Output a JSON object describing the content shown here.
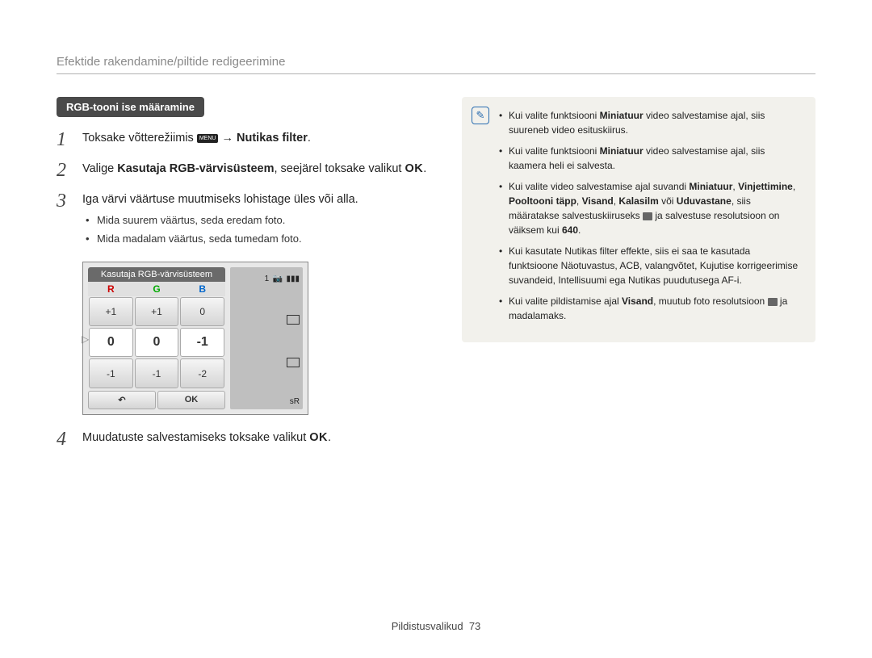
{
  "header": "Efektide rakendamine/piltide redigeerimine",
  "pill": "RGB-tooni ise määramine",
  "steps": {
    "s1_a": "Toksake võtterežiimis ",
    "s1_menu": "MENU",
    "s1_b": " → ",
    "s1_c": "Nutikas filter",
    "s1_d": ".",
    "s2_a": "Valige ",
    "s2_b": "Kasutaja RGB-värvisüsteem",
    "s2_c": ", seejärel toksake valikut ",
    "s2_ok": "OK",
    "s2_d": ".",
    "s3_a": "Iga värvi väärtuse muutmiseks lohistage üles või alla.",
    "s3_bul1": "Mida suurem väärtus, seda eredam foto.",
    "s3_bul2": "Mida madalam väärtus, seda tumedam foto.",
    "s4_a": "Muudatuste salvestamiseks toksake valikut ",
    "s4_ok": "OK",
    "s4_b": "."
  },
  "rgb": {
    "title": "Kasutaja RGB-värvisüsteem",
    "h_r": "R",
    "h_g": "G",
    "h_b": "B",
    "rows": [
      [
        "+1",
        "+1",
        "0"
      ],
      [
        "0",
        "0",
        "-1"
      ],
      [
        "-1",
        "-1",
        "-2"
      ]
    ],
    "back": "↶",
    "ok": "OK",
    "ind_top": "1",
    "sr_label": "sR"
  },
  "notes": {
    "n1_a": "Kui valite funktsiooni ",
    "n1_b": "Miniatuur",
    "n1_c": " video salvestamise ajal, siis suureneb video esituskiirus.",
    "n2_a": "Kui valite funktsiooni ",
    "n2_b": "Miniatuur",
    "n2_c": " video salvestamise ajal, siis kaamera heli ei salvesta.",
    "n3_a": "Kui valite video salvestamise ajal suvandi ",
    "n3_b": "Miniatuur",
    "n3_c": ", ",
    "n3_d": "Vinjettimine",
    "n3_e": ", ",
    "n3_f": "Pooltooni täpp",
    "n3_g": ", ",
    "n3_h": "Visand",
    "n3_i": ", ",
    "n3_j": "Kalasilm",
    "n3_k": " või ",
    "n3_l": "Uduvastane",
    "n3_m": ", siis määratakse salvestuskiiruseks ",
    "n3_n": " ja salvestuse resolutsioon on väiksem kui ",
    "n3_o": "640",
    "n3_p": ".",
    "n4": "Kui kasutate Nutikas filter effekte, siis ei saa te kasutada funktsioone Näotuvastus, ACB, valangvõtet, Kujutise korrigeerimise suvandeid, Intellisuumi ega Nutikas puudutusega AF-i.",
    "n5_a": "Kui valite pildistamise ajal ",
    "n5_b": "Visand",
    "n5_c": ", muutub foto resolutsioon ",
    "n5_d": " ja madalamaks."
  },
  "footer_a": "Pildistusvalikud",
  "footer_b": "73"
}
